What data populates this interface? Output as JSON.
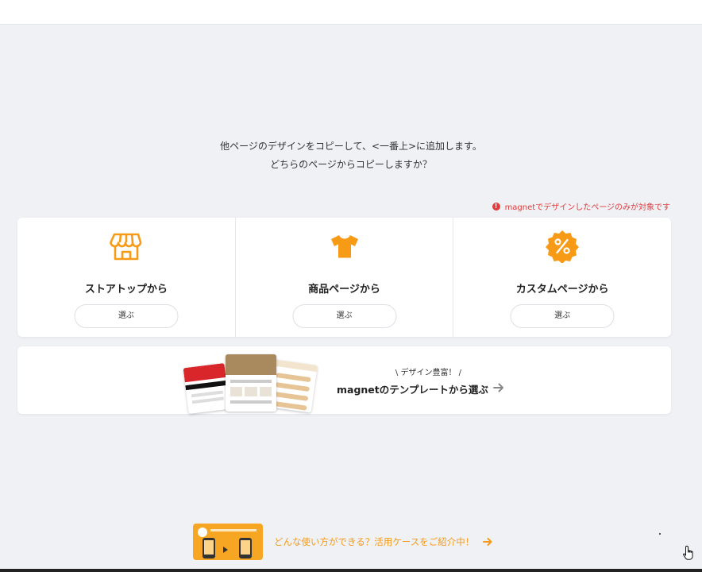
{
  "prompt": {
    "line1": "他ページのデザインをコピーして、<一番上>に追加します。",
    "line2": "どちらのページからコピーしますか？"
  },
  "notice": {
    "icon": "warning-circle-icon",
    "text": "magnetでデザインしたページのみが対象です",
    "color": "#e33b3b"
  },
  "choices": [
    {
      "icon": "storefront-icon",
      "title": "ストアトップから",
      "button": "選ぶ"
    },
    {
      "icon": "tshirt-icon",
      "title": "商品ページから",
      "button": "選ぶ"
    },
    {
      "icon": "percent-badge-icon",
      "title": "カスタムページから",
      "button": "選ぶ"
    }
  ],
  "template_card": {
    "subtitle": "\\ デザイン豊富！ /",
    "title": "magnetのテンプレートから選ぶ",
    "arrow_icon": "arrow-right-icon"
  },
  "promo": {
    "text": "どんな使い方ができる？活用ケースをご紹介中！",
    "arrow_icon": "arrow-right-icon",
    "color": "#f39a1e"
  },
  "colors": {
    "accent": "#f79a16",
    "background": "#eff1f5"
  }
}
